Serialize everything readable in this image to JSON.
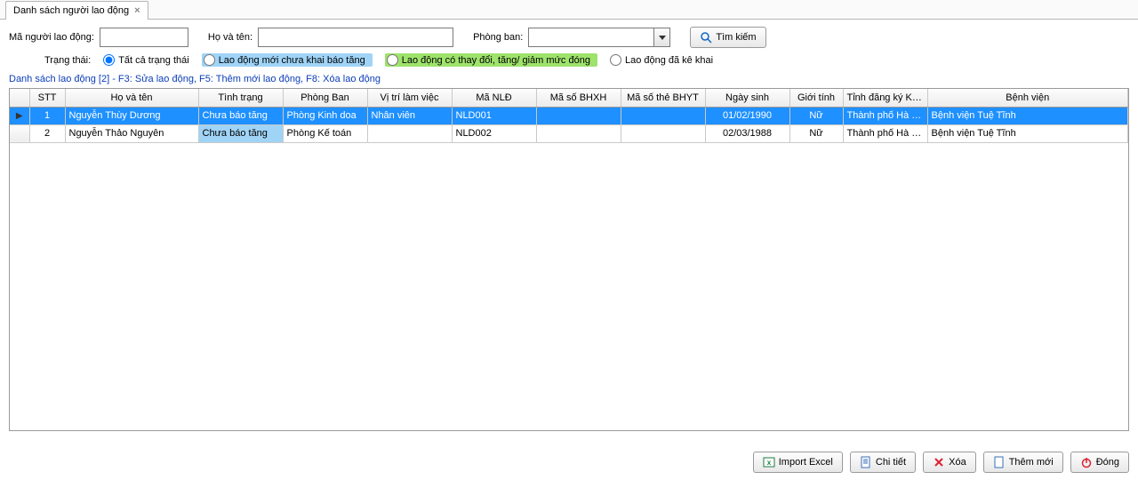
{
  "tab": {
    "title": "Danh sách người lao động"
  },
  "search": {
    "id_label": "Mã người lao động:",
    "name_label": "Họ và tên:",
    "dept_label": "Phòng ban:",
    "btn_label": "Tìm kiếm",
    "status_label": "Trạng thái:",
    "opts": {
      "all": "Tất cả trạng thái",
      "new": "Lao động mới chưa khai báo tăng",
      "changed": "Lao động có thay đổi, tăng/ giảm mức đóng",
      "declared": "Lao động đã kê khai"
    }
  },
  "caption": "Danh sách lao động [2] - F3: Sửa lao động, F5: Thêm mới lao động, F8: Xóa lao động",
  "grid": {
    "headers": {
      "stt": "STT",
      "name": "Họ và tên",
      "status": "Tình trạng",
      "dept": "Phòng Ban",
      "pos": "Vị trí làm việc",
      "mnld": "Mã NLĐ",
      "bhxh": "Mã số BHXH",
      "bhyt": "Mã số thẻ BHYT",
      "dob": "Ngày sinh",
      "sex": "Giới tính",
      "kcb": "Tỉnh đăng ký KCB",
      "hosp": "Bệnh viện"
    },
    "rows": [
      {
        "stt": "1",
        "name": "Nguyễn Thùy Dương",
        "status": "Chưa báo tăng",
        "dept": "Phòng Kinh doa",
        "pos": "Nhân viên",
        "mnld": "NLD001",
        "bhxh": "",
        "bhyt": "",
        "dob": "01/02/1990",
        "sex": "Nữ",
        "kcb": "Thành phố Hà Nội",
        "hosp": "Bệnh viện Tuệ Tĩnh"
      },
      {
        "stt": "2",
        "name": "Nguyễn Thảo Nguyên",
        "status": "Chưa báo tăng",
        "dept": "Phòng Kế toán",
        "pos": "",
        "mnld": "NLD002",
        "bhxh": "",
        "bhyt": "",
        "dob": "02/03/1988",
        "sex": "Nữ",
        "kcb": "Thành phố Hà Nội",
        "hosp": "Bệnh viện Tuệ Tĩnh"
      }
    ]
  },
  "buttons": {
    "import": "Import Excel",
    "detail": "Chi tiết",
    "delete": "Xóa",
    "new": "Thêm mới",
    "close": "Đóng"
  }
}
